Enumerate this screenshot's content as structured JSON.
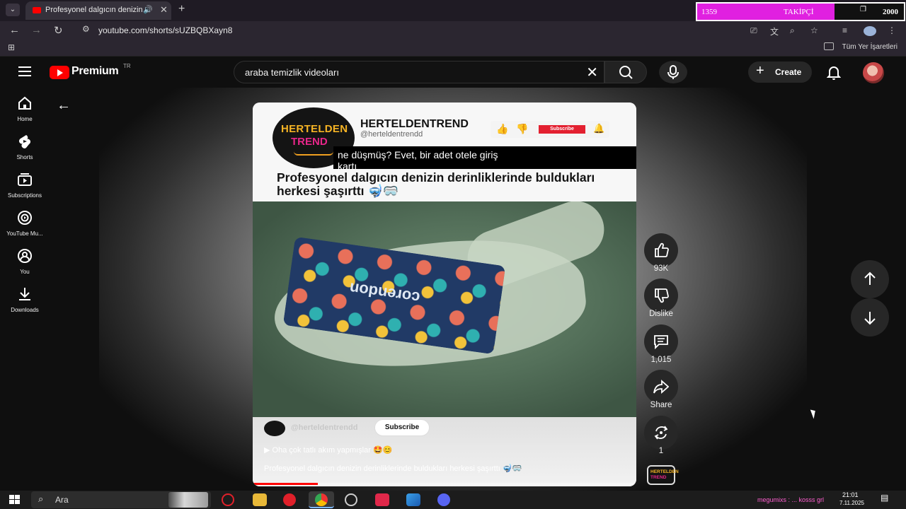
{
  "browser": {
    "tab_title": "Profesyonel dalgıcın denizin",
    "url": "youtube.com/shorts/sUZBQBXayn8",
    "bookmarks_label": "Tüm Yer İşaretleri"
  },
  "stream_overlay": {
    "current": "1359",
    "label": "TAKİPÇİ",
    "goal": "2000",
    "fill_fraction": 0.665
  },
  "youtube": {
    "brand": "Premium",
    "country": "TR",
    "search_query": "araba temizlik videoları",
    "create_label": "Create",
    "sidebar": [
      {
        "label": "Home",
        "icon": "home-icon"
      },
      {
        "label": "Shorts",
        "icon": "shorts-icon"
      },
      {
        "label": "Subscriptions",
        "icon": "subscriptions-icon"
      },
      {
        "label": "YouTube Mu...",
        "icon": "youtube-music-icon"
      },
      {
        "label": "You",
        "icon": "you-icon"
      },
      {
        "label": "Downloads",
        "icon": "download-icon"
      }
    ]
  },
  "video": {
    "badge_top": "HERTELDEN",
    "badge_bottom": "TREND",
    "channel_name": "HERTELDENTREND",
    "channel_handle": "@herteldentrendd",
    "mini_subscribe": "Subscribe",
    "caption_line1": "ne düşmüş? Evet, bir adet otele giriş",
    "caption_line2": "kartı",
    "headline": "Profesyonel dalgıcın denizin derinliklerinde buldukları herkesi şaşırttı 🤿🥽",
    "card_brand": "corendon",
    "overlay_handle": "@herteldentrendd",
    "subscribe_label": "Subscribe",
    "music_text": "▶  Oha çok tatlı akım yapmışlar 🤩😊",
    "description": "Profesyonel dalgıcın denizin derinliklerinde buldukları herkesi şaşırttı 🤿🥽",
    "progress": 0.17
  },
  "actions": {
    "likes": "93K",
    "dislike": "Dislike",
    "comments": "1,015",
    "share": "Share",
    "remix": "1"
  },
  "taskbar": {
    "search_placeholder": "Ara",
    "time": "21:01",
    "date": "7.11.2025",
    "ticker": "megumixs : ... kosss grl"
  }
}
